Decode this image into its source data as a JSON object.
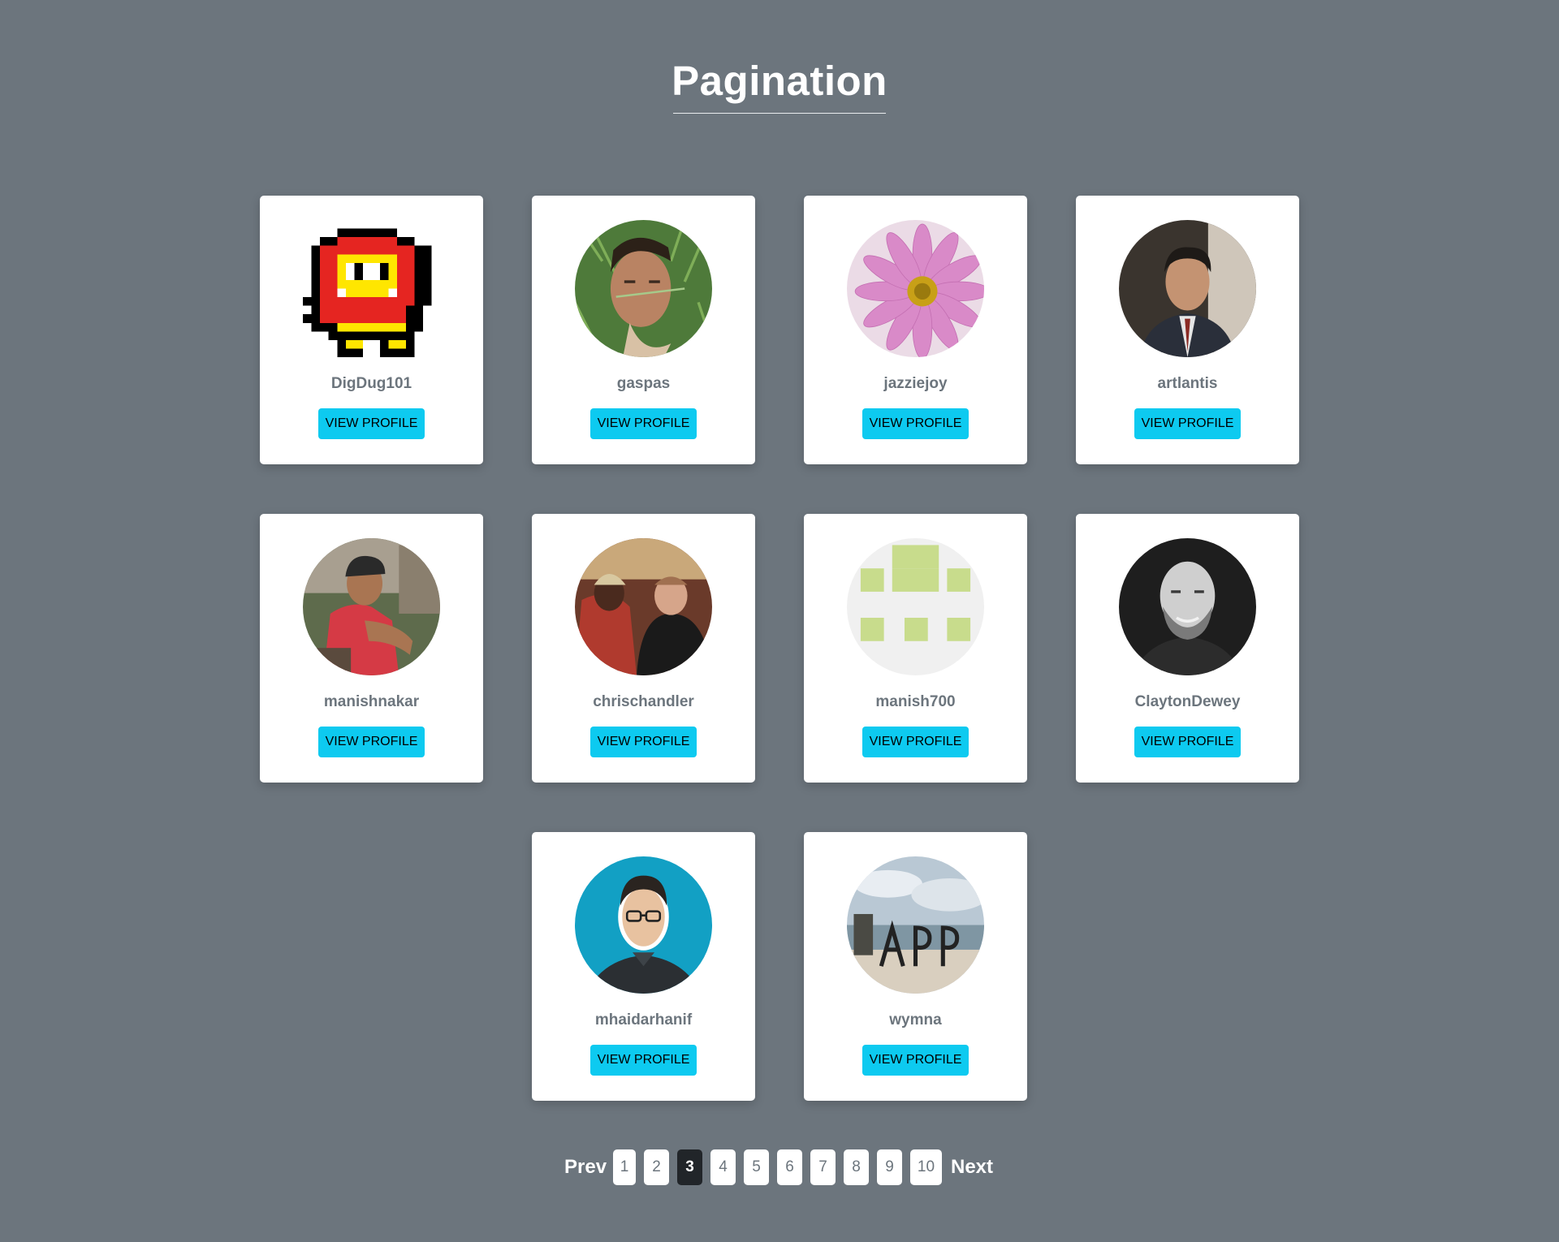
{
  "header": {
    "title": "Pagination"
  },
  "profiles": [
    {
      "username": "DigDug101",
      "button": "VIEW PROFILE",
      "avatar_icon": "pixel-character-avatar"
    },
    {
      "username": "gaspas",
      "button": "VIEW PROFILE",
      "avatar_icon": "man-in-grass-photo"
    },
    {
      "username": "jazziejoy",
      "button": "VIEW PROFILE",
      "avatar_icon": "pink-flower-photo"
    },
    {
      "username": "artlantis",
      "button": "VIEW PROFILE",
      "avatar_icon": "man-in-suit-photo"
    },
    {
      "username": "manishnakar",
      "button": "VIEW PROFILE",
      "avatar_icon": "man-in-red-vest-photo"
    },
    {
      "username": "chrischandler",
      "button": "VIEW PROFILE",
      "avatar_icon": "two-men-photo"
    },
    {
      "username": "manish700",
      "button": "VIEW PROFILE",
      "avatar_icon": "identicon-avatar"
    },
    {
      "username": "ClaytonDewey",
      "button": "VIEW PROFILE",
      "avatar_icon": "bald-bearded-man-photo"
    },
    {
      "username": "mhaidarhanif",
      "button": "VIEW PROFILE",
      "avatar_icon": "man-with-glasses-photo"
    },
    {
      "username": "wymna",
      "button": "VIEW PROFILE",
      "avatar_icon": "beach-photo"
    }
  ],
  "pagination": {
    "prev_label": "Prev",
    "next_label": "Next",
    "pages": [
      "1",
      "2",
      "3",
      "4",
      "5",
      "6",
      "7",
      "8",
      "9",
      "10"
    ],
    "current_page": "3"
  },
  "colors": {
    "background": "#6c757d",
    "card": "#ffffff",
    "button": "#0dcaf0",
    "active_page": "#212529"
  }
}
